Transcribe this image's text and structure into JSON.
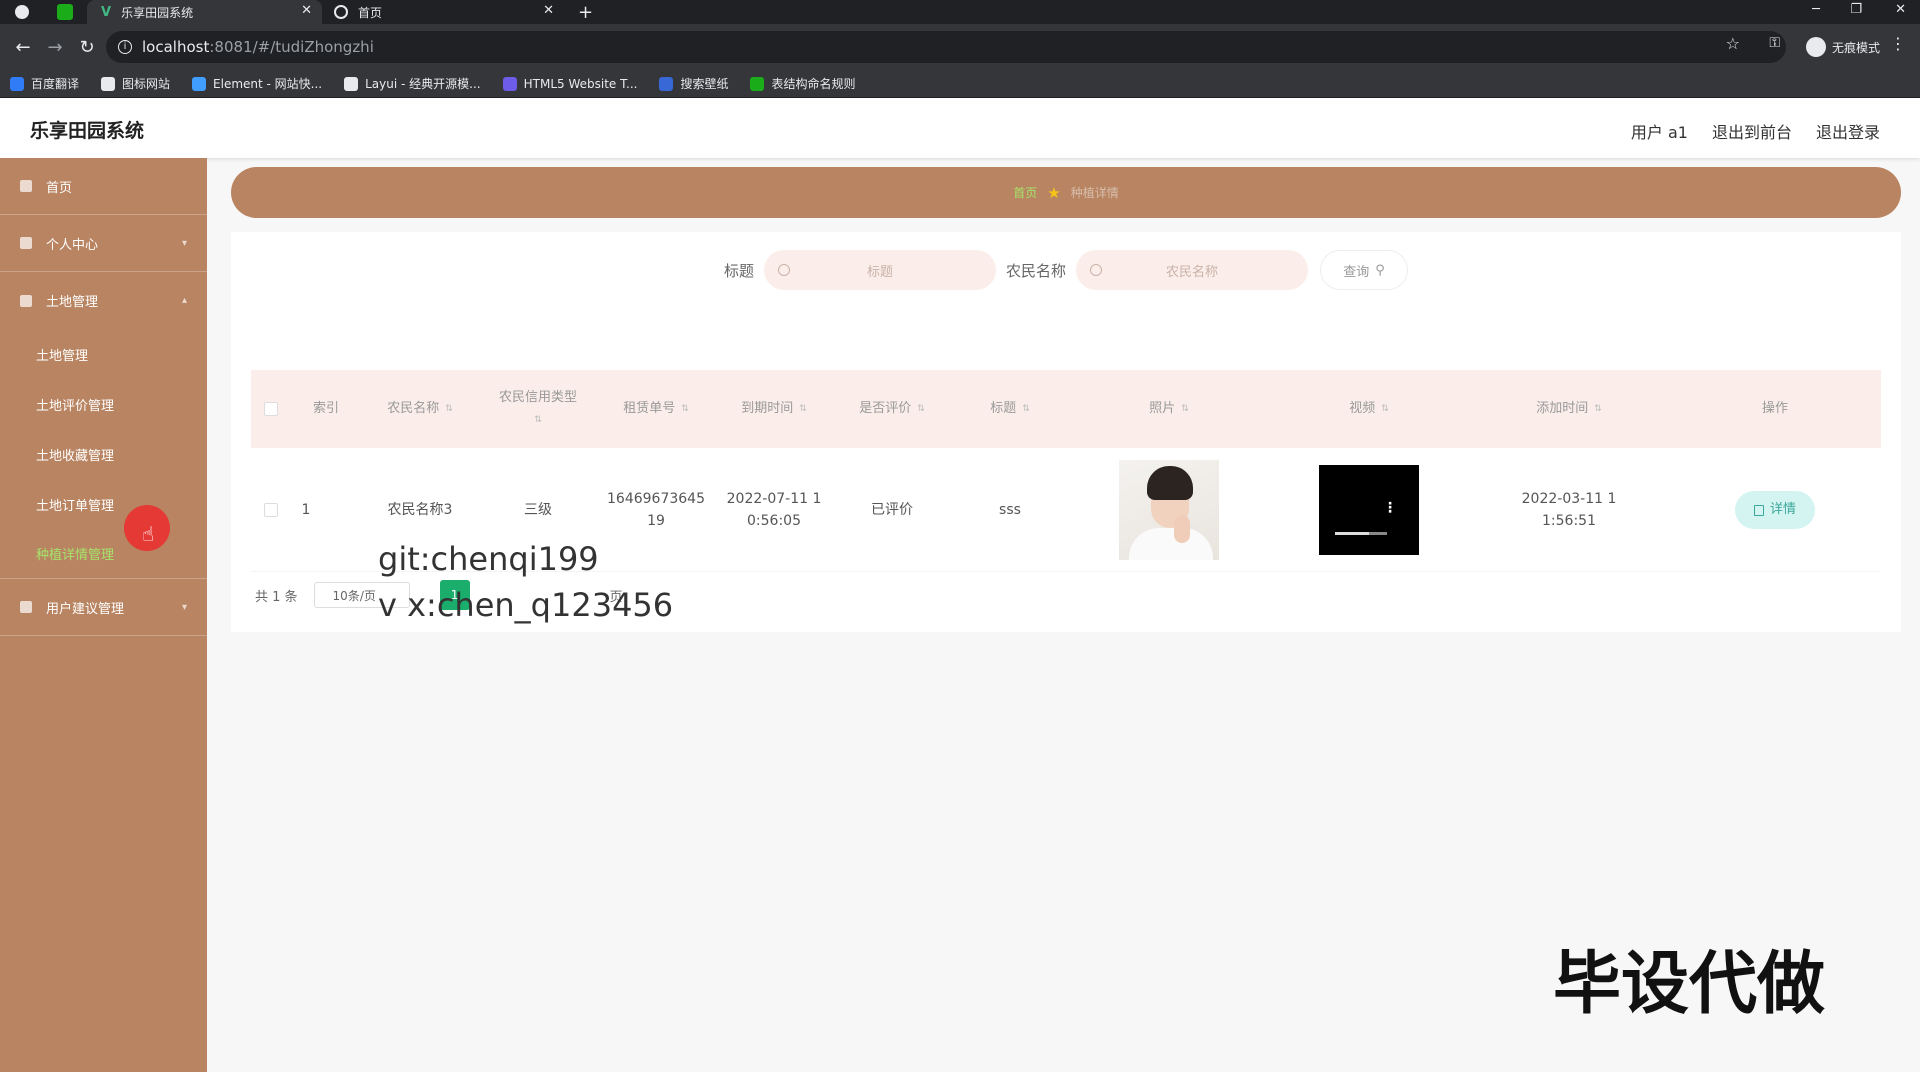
{
  "browser": {
    "tabs": [
      {
        "title": "乐享田园系统",
        "active": true
      },
      {
        "title": "首页",
        "active": false
      }
    ],
    "url_host": "localhost",
    "url_path": ":8081/#/tudiZhongzhi",
    "profile_label": "无痕模式",
    "bookmarks": [
      {
        "label": "百度翻译",
        "color": "#2f7cf6"
      },
      {
        "label": "图标网站",
        "color": "#e8eaed"
      },
      {
        "label": "Element - 网站快...",
        "color": "#409eff"
      },
      {
        "label": "Layui - 经典开源模...",
        "color": "#e8eaed"
      },
      {
        "label": "HTML5 Website T...",
        "color": "#6c5ce7"
      },
      {
        "label": "搜索壁纸",
        "color": "#3867d6"
      },
      {
        "label": "表结构命名规则",
        "color": "#1aad19"
      }
    ]
  },
  "header": {
    "title": "乐享田园系统",
    "links": [
      "用户 a1",
      "退出到前台",
      "退出登录"
    ]
  },
  "sidebar": {
    "items": [
      {
        "label": "首页"
      },
      {
        "label": "个人中心"
      },
      {
        "label": "土地管理"
      }
    ],
    "subitems": [
      "土地管理",
      "土地评价管理",
      "土地收藏管理",
      "土地订单管理",
      "种植详情管理"
    ],
    "bottom_item": "用户建议管理",
    "active_subitem": "种植详情管理"
  },
  "breadcrumb": {
    "home": "首页",
    "current": "种植详情"
  },
  "search": {
    "title_label": "标题",
    "title_placeholder": "标题",
    "farmer_label": "农民名称",
    "farmer_placeholder": "农民名称",
    "button_label": "查询"
  },
  "table": {
    "headers": [
      "索引",
      "农民名称",
      "农民信用类型",
      "租赁单号",
      "到期时间",
      "是否评价",
      "标题",
      "照片",
      "视频",
      "添加时间",
      "操作"
    ],
    "rows": [
      {
        "index": "1",
        "farmer_name": "农民名称3",
        "credit_type": "三级",
        "order_no_1": "16469673645",
        "order_no_2": "19",
        "expire_1": "2022-07-11 1",
        "expire_2": "0:56:05",
        "reviewed": "已评价",
        "title": "sss",
        "added_1": "2022-03-11 1",
        "added_2": "1:56:51",
        "action": "详情"
      }
    ]
  },
  "video_progress": 0.65,
  "pagination": {
    "total": "共 1 条",
    "page_size": "10条/页",
    "current": "1",
    "tail": "页"
  },
  "watermarks": {
    "line1": "git:chenqi199",
    "line2": "v x:chen_q123456",
    "corner": "毕设代做"
  }
}
